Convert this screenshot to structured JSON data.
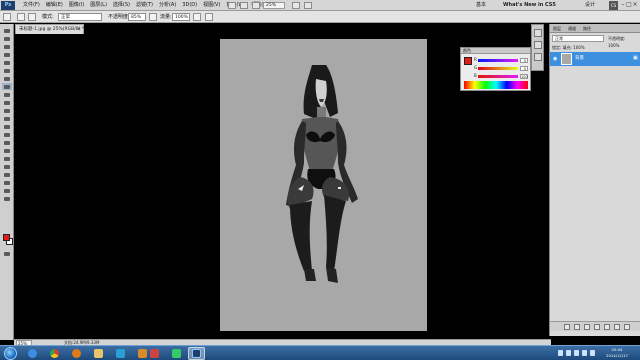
{
  "menubar": {
    "items": [
      "文件(F)",
      "编辑(E)",
      "图像(I)",
      "图层(L)",
      "选择(S)",
      "滤镜(T)",
      "分析(A)",
      "3D(D)",
      "视图(V)",
      "窗口(W)",
      "帮助(H)"
    ],
    "zoom": "25%",
    "workspace_basic": "基本",
    "workspace_whats_new": "What's New in CS5",
    "workspace_design": "设计",
    "cs_live": "CS",
    "minimize": "–",
    "restore": "□",
    "close": "×"
  },
  "options": {
    "mode_label": "模式:",
    "mode_value": "正常",
    "opacity_label": "不透明度:",
    "opacity_value": "85%",
    "flow_label": "流量:",
    "flow_value": "100%"
  },
  "document": {
    "tab_title": "未标题-1.jpg @ 25%(RGB/8) *",
    "tab_close": "×"
  },
  "status": {
    "zoom": "25%",
    "doc_info": "文档:24.9M/9.33M"
  },
  "color_panel": {
    "title": "颜色",
    "sliders": [
      {
        "label": "R",
        "value": "0"
      },
      {
        "label": "G",
        "value": "0"
      },
      {
        "label": "B",
        "value": "100"
      }
    ],
    "foreground_color": "#e31b1b",
    "background_color": "#ffffff"
  },
  "layers_panel": {
    "tabs": [
      "图层",
      "通道",
      "路径"
    ],
    "blend_mode": "正常",
    "opacity": "不透明度: 100%",
    "lock": "锁定:   填充: 100%",
    "layer_name": "背景",
    "selection_color": "#3d8fe0"
  },
  "taskbar": {
    "clock_time": "20:04",
    "clock_date": "2014/12/17"
  }
}
